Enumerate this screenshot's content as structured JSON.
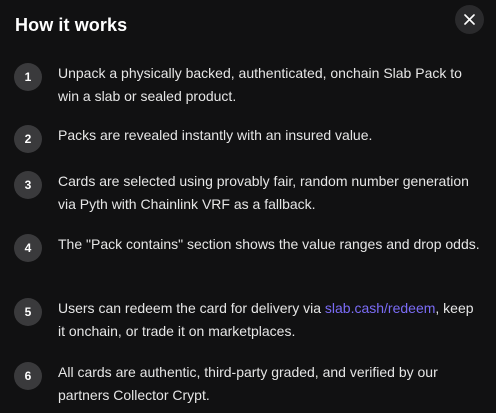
{
  "modal": {
    "title": "How it works",
    "close_icon": "close-icon"
  },
  "steps": [
    {
      "number": "1",
      "text": "Unpack a physically backed, authenticated, onchain Slab Pack to win a slab or sealed product."
    },
    {
      "number": "2",
      "text": "Packs are revealed instantly with an insured value."
    },
    {
      "number": "3",
      "text": "Cards are selected using provably fair, random number generation via Pyth with Chainlink VRF as a fallback."
    },
    {
      "number": "4",
      "text": "The \"Pack contains\" section shows the value ranges and drop odds."
    },
    {
      "number": "5",
      "text_before": "Users can redeem the card for delivery via ",
      "link": "slab.cash/redeem",
      "text_after": ", keep it onchain, or trade it on marketplaces."
    },
    {
      "number": "6",
      "text": "All cards are authentic, third-party graded, and verified by our partners Collector Crypt."
    }
  ],
  "colors": {
    "background": "#111112",
    "badge": "#3a3a3c",
    "link": "#7b6cf6",
    "text": "#e6e6e6"
  }
}
